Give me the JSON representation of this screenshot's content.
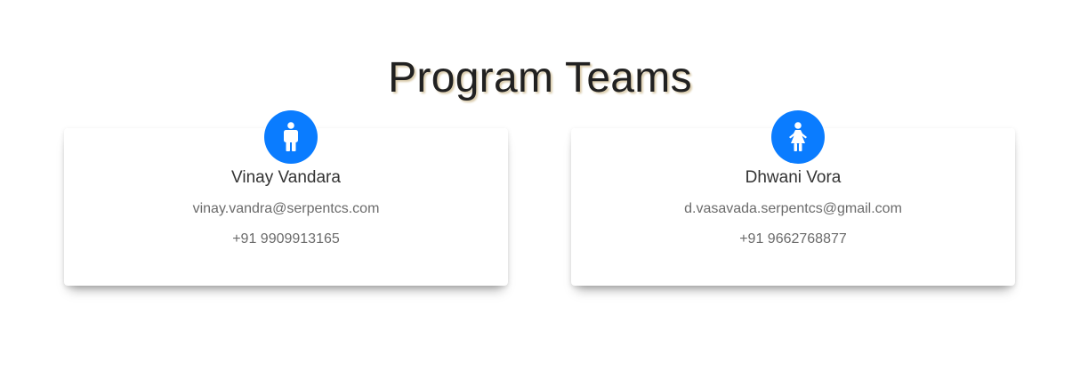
{
  "page": {
    "title": "Program Teams"
  },
  "theme": {
    "accent": "#0a7cff"
  },
  "members": [
    {
      "name": "Vinay Vandara",
      "email": "vinay.vandra@serpentcs.com",
      "phone": "+91 9909913165",
      "icon": "male-icon"
    },
    {
      "name": "Dhwani Vora",
      "email": "d.vasavada.serpentcs@gmail.com",
      "phone": "+91 9662768877",
      "icon": "female-icon"
    }
  ]
}
